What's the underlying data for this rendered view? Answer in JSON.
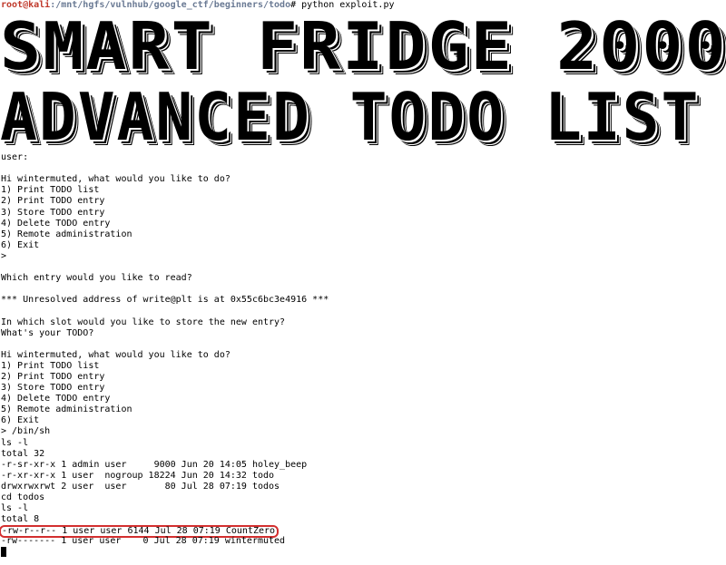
{
  "prompt": {
    "user_host": "root@kali",
    "path": ":/mnt/hgfs/vulnhub/google_ctf/beginners/todo",
    "symbol": "# ",
    "command": "python exploit.py"
  },
  "banner": {
    "line1": "SMART FRIDGE 2000",
    "line2": "ADVANCED TODO LIST"
  },
  "output": {
    "lines_before_highlight": [
      "user:",
      "",
      "Hi wintermuted, what would you like to do?",
      "1) Print TODO list",
      "2) Print TODO entry",
      "3) Store TODO entry",
      "4) Delete TODO entry",
      "5) Remote administration",
      "6) Exit",
      ">",
      "",
      "Which entry would you like to read?",
      "",
      "*** Unresolved address of write@plt is at 0x55c6bc3e4916 ***",
      "",
      "In which slot would you like to store the new entry?",
      "What's your TODO?",
      "",
      "Hi wintermuted, what would you like to do?",
      "1) Print TODO list",
      "2) Print TODO entry",
      "3) Store TODO entry",
      "4) Delete TODO entry",
      "5) Remote administration",
      "6) Exit",
      "> /bin/sh",
      "ls -l",
      "total 32",
      "-r-sr-xr-x 1 admin user     9000 Jun 20 14:05 holey_beep",
      "-r-xr-xr-x 1 user  nogroup 18224 Jun 20 14:32 todo",
      "drwxrwxrwt 2 user  user       80 Jul 28 07:19 todos",
      "cd todos",
      "ls -l",
      "total 8"
    ],
    "highlighted_line": "-rw-r--r-- 1 user user 6144 Jul 28 07:19 CountZero",
    "lines_after_highlight": [
      "-rw------- 1 user user    0 Jul 28 07:19 wintermuted"
    ]
  },
  "colors": {
    "background": "#ffffff",
    "text": "#000000",
    "prompt_user": "#c0392b",
    "prompt_path": "#6a7a94",
    "highlight_border": "#d32f2f"
  }
}
